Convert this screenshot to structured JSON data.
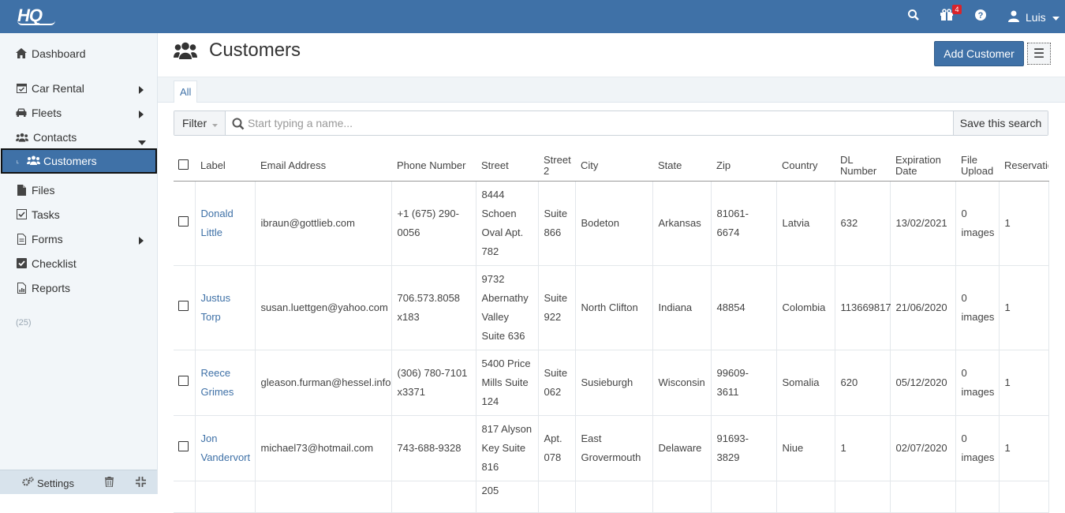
{
  "app": {
    "logo": "HQ"
  },
  "topbar": {
    "notification_count": "4",
    "user_name": "Luis"
  },
  "sidebar": {
    "items": [
      {
        "label": "Dashboard"
      },
      {
        "label": "Car Rental"
      },
      {
        "label": "Fleets"
      },
      {
        "label": "Contacts"
      },
      {
        "label": "Customers"
      },
      {
        "label": "Files"
      },
      {
        "label": "Tasks"
      },
      {
        "label": "Forms"
      },
      {
        "label": "Checklist"
      },
      {
        "label": "Reports"
      }
    ],
    "count": "(25)",
    "footer": {
      "settings_label": "Settings"
    }
  },
  "page": {
    "title": "Customers",
    "add_button": "Add Customer",
    "menu_glyph": "☰",
    "tabs": [
      {
        "label": "All"
      }
    ]
  },
  "filter": {
    "label": "Filter",
    "placeholder": "Start typing a name...",
    "save_label": "Save this search"
  },
  "table": {
    "headers": [
      "Label",
      "Email Address",
      "Phone Number",
      "Street",
      "Street 2",
      "City",
      "State",
      "Zip",
      "Country",
      "DL Number",
      "Expiration Date",
      "File Upload",
      "Reservation Count"
    ],
    "rows": [
      [
        "Donald Little",
        "ibraun@gottlieb.com",
        "+1 (675) 290-0056",
        "8444 Schoen Oval Apt. 782",
        "Suite 866",
        "Bodeton",
        "Arkansas",
        "81061-6674",
        "Latvia",
        "632",
        "13/02/2021",
        "0 images",
        "1"
      ],
      [
        "Justus Torp",
        "susan.luettgen@yahoo.com",
        "706.573.8058 x183",
        "9732 Abernathy Valley Suite 636",
        "Suite 922",
        "North Clifton",
        "Indiana",
        "48854",
        "Colombia",
        "113669817",
        "21/06/2020",
        "0 images",
        "1"
      ],
      [
        "Reece Grimes",
        "gleason.furman@hessel.info",
        "(306) 780-7101 x3371",
        "5400 Price Mills Suite 124",
        "Suite 062",
        "Susieburgh",
        "Wisconsin",
        "99609-3611",
        "Somalia",
        "620",
        "05/12/2020",
        "0 images",
        "1"
      ],
      [
        "Jon Vandervort",
        "michael73@hotmail.com",
        "743-688-9328",
        "817 Alyson Key Suite 816",
        "Apt. 078",
        "East Grovermouth",
        "Delaware",
        "91693-3829",
        "Niue",
        "1",
        "02/07/2020",
        "0 images",
        "1"
      ],
      [
        "",
        "",
        "",
        "205",
        "",
        "",
        "",
        "",
        "",
        "",
        "",
        "",
        ""
      ]
    ]
  }
}
